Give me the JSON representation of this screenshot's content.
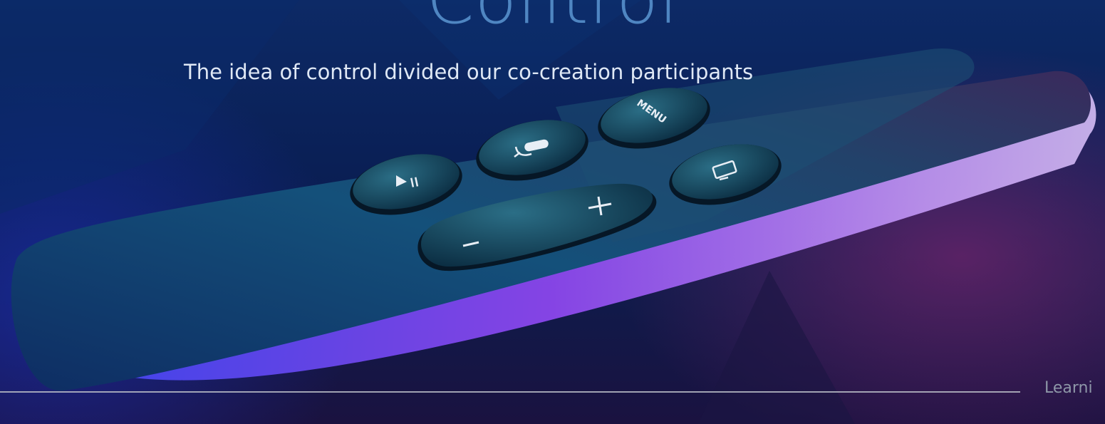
{
  "slide": {
    "title": "Control",
    "subtitle": "The idea of control divided our co-creation participants",
    "footer": "Learni"
  },
  "remote": {
    "menu_label": "MENU",
    "icons": [
      "play-pause-icon",
      "microphone-icon",
      "tv-screen-icon",
      "plus-icon",
      "minus-icon"
    ]
  },
  "colors": {
    "title": "#4f86c2",
    "subtitle": "#dfe8f5",
    "footer_text": "#8e97a8",
    "rule": "#b8bcc6",
    "remote_body": "#0f3e6e",
    "edge_glow": "#a24cff"
  }
}
